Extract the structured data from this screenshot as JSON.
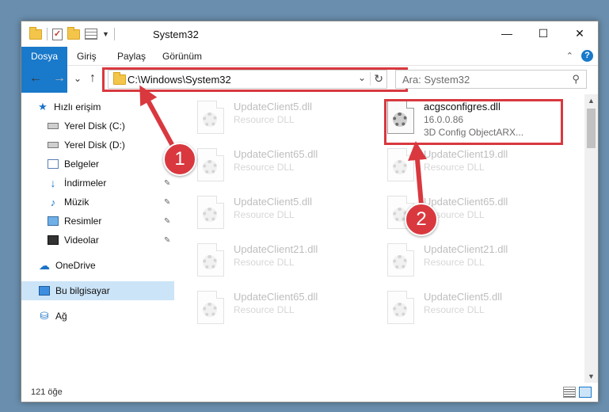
{
  "window": {
    "title": "System32"
  },
  "titlebar_buttons": {
    "minimize": "—",
    "maximize": "☐",
    "close": "✕"
  },
  "ribbon": {
    "tabs": [
      "Dosya",
      "Giriş",
      "Paylaş",
      "Görünüm"
    ],
    "collapse": "⌃",
    "help": "?"
  },
  "nav": {
    "back": "←",
    "forward": "→",
    "recent": "⌄",
    "up": "↑",
    "address": "C:\\Windows\\System32",
    "dropdown": "⌄",
    "refresh": "↻",
    "search_placeholder": "Ara: System32",
    "search_icon": "⚲"
  },
  "sidebar": {
    "items": [
      {
        "label": "Hızlı erişim",
        "icon": "star-icon",
        "pinned": false
      },
      {
        "label": "Yerel Disk (C:)",
        "icon": "disk-icon",
        "pinned": false
      },
      {
        "label": "Yerel Disk (D:)",
        "icon": "disk-icon",
        "pinned": false
      },
      {
        "label": "Belgeler",
        "icon": "documents-icon",
        "pinned": true
      },
      {
        "label": "İndirmeler",
        "icon": "downloads-icon",
        "pinned": true
      },
      {
        "label": "Müzik",
        "icon": "music-icon",
        "pinned": true
      },
      {
        "label": "Resimler",
        "icon": "pictures-icon",
        "pinned": true
      },
      {
        "label": "Videolar",
        "icon": "videos-icon",
        "pinned": true
      },
      {
        "label": "OneDrive",
        "icon": "cloud-icon",
        "pinned": false
      },
      {
        "label": "Bu bilgisayar",
        "icon": "pc-icon",
        "pinned": false,
        "selected": true
      },
      {
        "label": "Ağ",
        "icon": "network-icon",
        "pinned": false
      }
    ],
    "pin_glyph": "📌"
  },
  "files": {
    "left": [
      {
        "name": "UpdateClient5.dll",
        "type": "Resource DLL"
      },
      {
        "name": "UpdateClient65.dll",
        "type": "Resource DLL"
      },
      {
        "name": "UpdateClient5.dll",
        "type": "Resource DLL"
      },
      {
        "name": "UpdateClient21.dll",
        "type": "Resource DLL"
      },
      {
        "name": "UpdateClient65.dll",
        "type": "Resource DLL"
      }
    ],
    "highlighted": {
      "name": "acgsconfigres.dll",
      "version": "16.0.0.86",
      "description": "3D Config ObjectARX..."
    },
    "right": [
      {
        "name": "UpdateClient19.dll",
        "type": "Resource DLL"
      },
      {
        "name": "UpdateClient65.dll",
        "type": "Resource DLL"
      },
      {
        "name": "UpdateClient21.dll",
        "type": "Resource DLL"
      },
      {
        "name": "UpdateClient5.dll",
        "type": "Resource DLL"
      }
    ]
  },
  "statusbar": {
    "count": "121 öğe"
  },
  "annotations": {
    "step1": "1",
    "step2": "2"
  },
  "colors": {
    "accent": "#1979ca",
    "highlight": "#d9383f",
    "selected_bg": "#cce4f7"
  }
}
